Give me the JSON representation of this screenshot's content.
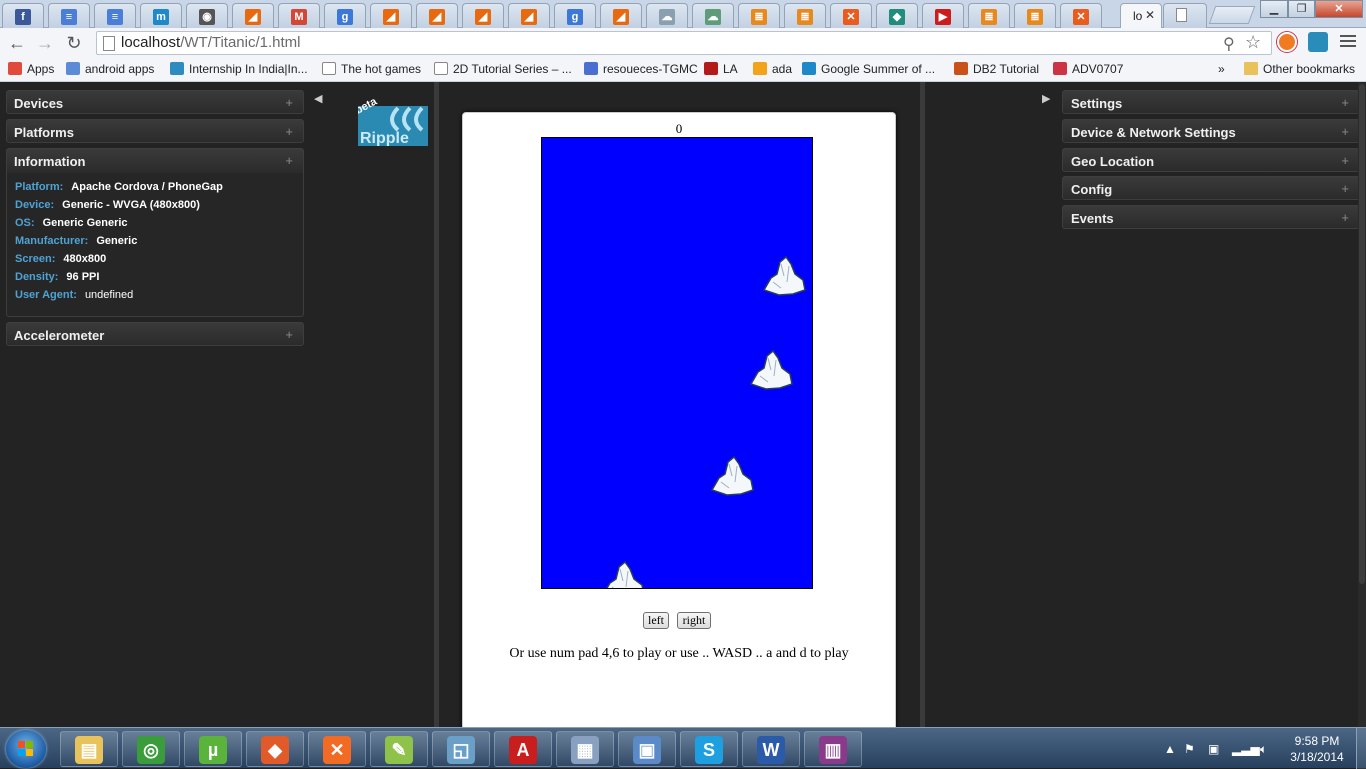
{
  "browser": {
    "active_tab": {
      "label": "lo"
    },
    "url": {
      "domain": "localhost",
      "path": "/WT/Titanic/1.html"
    },
    "tab_icons": [
      {
        "name": "facebook",
        "color": "#3b5998",
        "glyph": "f"
      },
      {
        "name": "google-docs",
        "color": "#4a7ed8",
        "glyph": "≡"
      },
      {
        "name": "google-docs",
        "color": "#4a7ed8",
        "glyph": "≡"
      },
      {
        "name": "moodle",
        "color": "#1e88c9",
        "glyph": "m"
      },
      {
        "name": "media",
        "color": "#555555",
        "glyph": "◉"
      },
      {
        "name": "blogger",
        "color": "#e86a10",
        "glyph": "◢"
      },
      {
        "name": "gmail",
        "color": "#d14836",
        "glyph": "M"
      },
      {
        "name": "google",
        "color": "#3c78d8",
        "glyph": "g"
      },
      {
        "name": "blogger",
        "color": "#e86a10",
        "glyph": "◢"
      },
      {
        "name": "blogger",
        "color": "#e86a10",
        "glyph": "◢"
      },
      {
        "name": "blogger",
        "color": "#e86a10",
        "glyph": "◢"
      },
      {
        "name": "blogger",
        "color": "#e86a10",
        "glyph": "◢"
      },
      {
        "name": "google",
        "color": "#3c78d8",
        "glyph": "g"
      },
      {
        "name": "blogger",
        "color": "#e86a10",
        "glyph": "◢"
      },
      {
        "name": "cloud",
        "color": "#8aa0b0",
        "glyph": "☁"
      },
      {
        "name": "cloud",
        "color": "#5f9c7a",
        "glyph": "☁"
      },
      {
        "name": "stackoverflow",
        "color": "#e8891d",
        "glyph": "≣"
      },
      {
        "name": "stackoverflow",
        "color": "#e8891d",
        "glyph": "≣"
      },
      {
        "name": "xampp",
        "color": "#e85d1d",
        "glyph": "✕"
      },
      {
        "name": "app",
        "color": "#1f8c7c",
        "glyph": "◆"
      },
      {
        "name": "youtube",
        "color": "#cc1c1c",
        "glyph": "▶"
      },
      {
        "name": "stackoverflow",
        "color": "#e8891d",
        "glyph": "≣"
      },
      {
        "name": "stackoverflow",
        "color": "#e8891d",
        "glyph": "≣"
      },
      {
        "name": "xampp",
        "color": "#e85d1d",
        "glyph": "✕"
      }
    ],
    "bookmarks": [
      {
        "label": "Apps",
        "color": "#e14b3b"
      },
      {
        "label": "android apps",
        "color": "#5b8bd6"
      },
      {
        "label": "Internship In India|In...",
        "color": "#2d8bc0"
      },
      {
        "label": "The hot games",
        "color": "#ffffff"
      },
      {
        "label": "2D Tutorial Series – ...",
        "color": "#ffffff"
      },
      {
        "label": "resoueces-TGMC",
        "color": "#4a6fd0"
      },
      {
        "label": "LA",
        "color": "#b31b1b"
      },
      {
        "label": "ada",
        "color": "#f2a31b"
      },
      {
        "label": "Google Summer of ...",
        "color": "#1e88c9"
      },
      {
        "label": "DB2 Tutorial",
        "color": "#c8521a"
      },
      {
        "label": "ADV0707",
        "color": "#cc3344"
      }
    ],
    "bookmarks_overflow": "»",
    "other_bookmarks": "Other bookmarks"
  },
  "left_panels": {
    "devices": "Devices",
    "platforms": "Platforms",
    "information": "Information",
    "accelerometer": "Accelerometer",
    "plus": "+"
  },
  "information": {
    "rows": [
      {
        "key": "Platform:",
        "value": "Apache Cordova / PhoneGap"
      },
      {
        "key": "Device:",
        "value": "Generic - WVGA (480x800)"
      },
      {
        "key": "OS:",
        "value": "Generic Generic"
      },
      {
        "key": "Manufacturer:",
        "value": "Generic"
      },
      {
        "key": "Screen:",
        "value": "480x800"
      },
      {
        "key": "Density:",
        "value": "96 PPI"
      },
      {
        "key": "User Agent:",
        "value": "undefined"
      }
    ]
  },
  "ripple": {
    "logo_text": "Ripple",
    "badge": "beta"
  },
  "game": {
    "score": "0",
    "left_button": "left",
    "right_button": "right",
    "instructions": "Or use num pad 4,6 to play or use .. WASD .. a and d to play",
    "water_color": "#0000ff"
  },
  "right_panels": {
    "settings": "Settings",
    "device_network": "Device & Network Settings",
    "geo": "Geo Location",
    "config": "Config",
    "events": "Events"
  },
  "taskbar": {
    "time": "9:58 PM",
    "date": "3/18/2014",
    "apps": [
      {
        "name": "explorer",
        "color": "#e8c25a",
        "glyph": "▤"
      },
      {
        "name": "chrome",
        "color": "#3a9c3a",
        "glyph": "◎"
      },
      {
        "name": "utorrent",
        "color": "#5ab33a",
        "glyph": "µ"
      },
      {
        "name": "git",
        "color": "#e05a2a",
        "glyph": "◆"
      },
      {
        "name": "xampp",
        "color": "#f26b24",
        "glyph": "✕"
      },
      {
        "name": "notepad-plus",
        "color": "#8fc24a",
        "glyph": "✎"
      },
      {
        "name": "sublime",
        "color": "#6aa0c8",
        "glyph": "◱"
      },
      {
        "name": "acrobat",
        "color": "#c81e1e",
        "glyph": "A"
      },
      {
        "name": "calculator",
        "color": "#8aa0c0",
        "glyph": "▦"
      },
      {
        "name": "virtualbox",
        "color": "#5a8ac8",
        "glyph": "▣"
      },
      {
        "name": "skype",
        "color": "#1ea0e0",
        "glyph": "S"
      },
      {
        "name": "word",
        "color": "#2b5aa8",
        "glyph": "W"
      },
      {
        "name": "winrar",
        "color": "#8a3a8a",
        "glyph": "▥"
      }
    ]
  }
}
